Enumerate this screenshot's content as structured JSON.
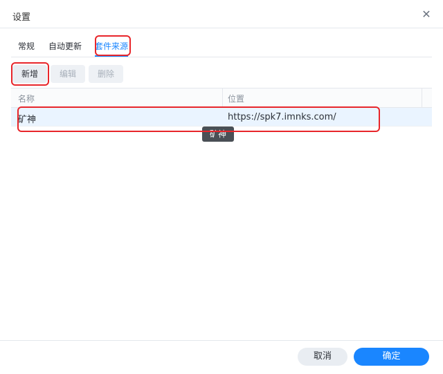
{
  "dialog": {
    "title": "设置",
    "close_icon": "close-icon"
  },
  "tabs": [
    {
      "label": "常规",
      "active": false
    },
    {
      "label": "自动更新",
      "active": false
    },
    {
      "label": "套件来源",
      "active": true
    }
  ],
  "toolbar": {
    "add_label": "新增",
    "edit_label": "编辑",
    "delete_label": "删除"
  },
  "table": {
    "columns": [
      "名称",
      "位置"
    ],
    "rows": [
      {
        "name": "矿神",
        "location": "https://spk7.imnks.com/"
      }
    ]
  },
  "tooltip": {
    "text": "矿神"
  },
  "footer": {
    "cancel_label": "取消",
    "ok_label": "确定"
  },
  "colors": {
    "accent": "#1a86ff",
    "highlight": "#e8252a"
  }
}
